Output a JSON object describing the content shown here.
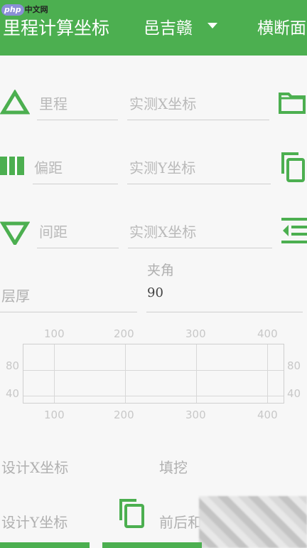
{
  "header": {
    "title": "里程计算坐标",
    "location": "邑吉赣",
    "right_title": "横断面"
  },
  "watermark": {
    "php": "php",
    "site": "中文网"
  },
  "form": {
    "mileage_placeholder": "里程",
    "x_placeholder_1": "实测X坐标",
    "offset_placeholder": "偏距",
    "y_placeholder": "实测Y坐标",
    "spacing_placeholder": "间距",
    "x_placeholder_2": "实测X坐标",
    "angle_label": "夹角",
    "thickness_label": "层厚",
    "angle_value": "90"
  },
  "chart_data": {
    "type": "line",
    "x_ticks_top": [
      "100",
      "200",
      "300",
      "400"
    ],
    "x_ticks_bottom": [
      "100",
      "200",
      "300",
      "400"
    ],
    "y_ticks_left": [
      "80",
      "40"
    ],
    "y_ticks_right": [
      "80",
      "40"
    ],
    "series": []
  },
  "bottom": {
    "design_x_label": "设计X坐标",
    "fill_cut_label": "填挖",
    "design_y_label": "设计Y坐标",
    "front_back_label": "前后和"
  },
  "colors": {
    "accent": "#4caf50"
  }
}
